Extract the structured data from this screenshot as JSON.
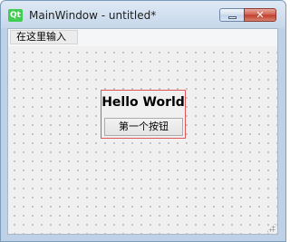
{
  "window": {
    "title": "MainWindow - untitled*",
    "logo_text": "Qt",
    "close_glyph": "✕"
  },
  "menubar": {
    "input_placeholder": "在这里输入"
  },
  "form": {
    "label_text": "Hello World",
    "button_text": "第一个按钮"
  },
  "colors": {
    "selection_border": "#e05555",
    "qt_logo": "#41cd52",
    "close_button": "#c74a39"
  },
  "icons": {
    "app": "qt-logo-icon",
    "minimize": "minimize-icon",
    "close": "close-icon",
    "resize": "size-grip-icon"
  }
}
